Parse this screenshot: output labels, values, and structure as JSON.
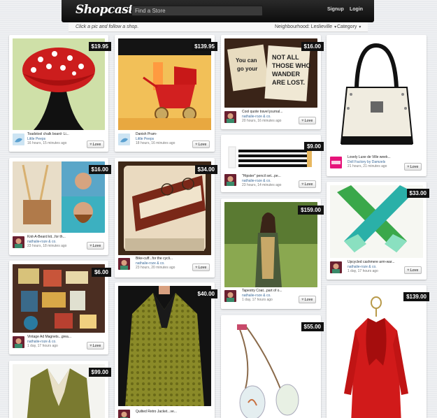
{
  "header": {
    "logo": "Shopcastr",
    "search_placeholder": "Find a Store",
    "signup": "Signup",
    "login": "Login"
  },
  "subbar": {
    "tagline": "Click a pic and follow a shop.",
    "neighbourhood": "Neighbourhood: Leslieville",
    "category": "Category"
  },
  "love_label": "Love",
  "cards": [
    {
      "title": "Toadstool chalk board- Li...",
      "seller": "Little Peeps",
      "time": "16 hours, 15 minutes ago",
      "price": "$19.95"
    },
    {
      "title": "Danish Pram-",
      "seller": "Little Peeps",
      "time": "18 hours, 16 minutes ago",
      "price": "$139.95"
    },
    {
      "title": "Cool quote travel journal...",
      "seller": "nathalie-roze & co.",
      "time": "20 hours, 16 minutes ago",
      "price": "$16.00"
    },
    {
      "title": "Lovely Luxe de Ville week...",
      "seller": "Doll Factory by Damzels",
      "time": "21 hours, 21 minutes ago",
      "price": ""
    },
    {
      "title": "\"Hipster\" pencil set...pe...",
      "seller": "nathalie-roze & co.",
      "time": "23 hours, 14 minutes ago",
      "price": "$9.00"
    },
    {
      "title": "Knit-A-Beard kit...for th...",
      "seller": "nathalie-roze & co.",
      "time": "23 hours, 18 minutes ago",
      "price": "$16.00"
    },
    {
      "title": "Bike-cuff...for the cycli...",
      "seller": "nathalie-roze & co.",
      "time": "23 hours, 20 minutes ago",
      "price": "$34.00"
    },
    {
      "title": "Upcycled cashmere arm-war...",
      "seller": "nathalie-roze & co.",
      "time": "1 day, 17 hours ago",
      "price": "$33.00"
    },
    {
      "title": "Tapestry Coat...part of o...",
      "seller": "nathalie-roze & co.",
      "time": "1 day, 17 hours ago",
      "price": "$159.00"
    },
    {
      "title": "Vintage Ad Magnets...grea...",
      "seller": "nathalie-roze & co.",
      "time": "1 day, 17 hours ago",
      "price": "$6.00"
    },
    {
      "title": "Quilted Retro Jacket...ve...",
      "seller": "",
      "time": "",
      "price": "$40.00"
    },
    {
      "title": "",
      "seller": "",
      "time": "",
      "price": "$55.00"
    },
    {
      "title": "",
      "seller": "",
      "time": "",
      "price": "$99.00"
    },
    {
      "title": "",
      "seller": "",
      "time": "",
      "price": "$139.00"
    }
  ],
  "colors": {
    "topbar": "#111111",
    "background": "#e9ebee",
    "price_tag": "#111111",
    "seller_link": "#3a6a9a"
  },
  "icons": {
    "heart": "heart-icon",
    "caret": "caret-down-icon"
  }
}
